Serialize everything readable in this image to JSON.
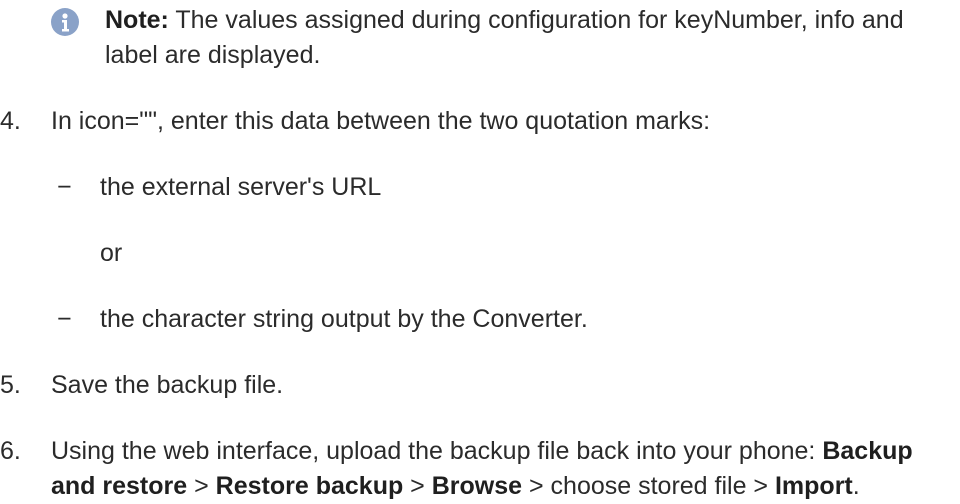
{
  "note": {
    "label": "Note:",
    "text": " The values assigned during configuration for keyNumber, info and label are displayed."
  },
  "step4": {
    "number": "4.",
    "text": "In icon=\"\", enter this data between the two quotation marks:",
    "dash": "−",
    "option1": "the external server's URL",
    "or": "or",
    "option2": "the character string output by the Converter."
  },
  "step5": {
    "number": "5.",
    "text": "Save the backup file."
  },
  "step6": {
    "number": "6.",
    "intro": "Using the web interface, upload the backup file back into your phone:",
    "path1": "Backup and restore",
    "sep": " > ",
    "path2": "Restore backup",
    "path3": "Browse",
    "mid": " > choose stored file > ",
    "path4": "Import",
    "end": "."
  },
  "icons": {
    "note": "info-icon"
  },
  "colors": {
    "text": "#2b2b2b",
    "info_icon": "#8aa2c8"
  }
}
